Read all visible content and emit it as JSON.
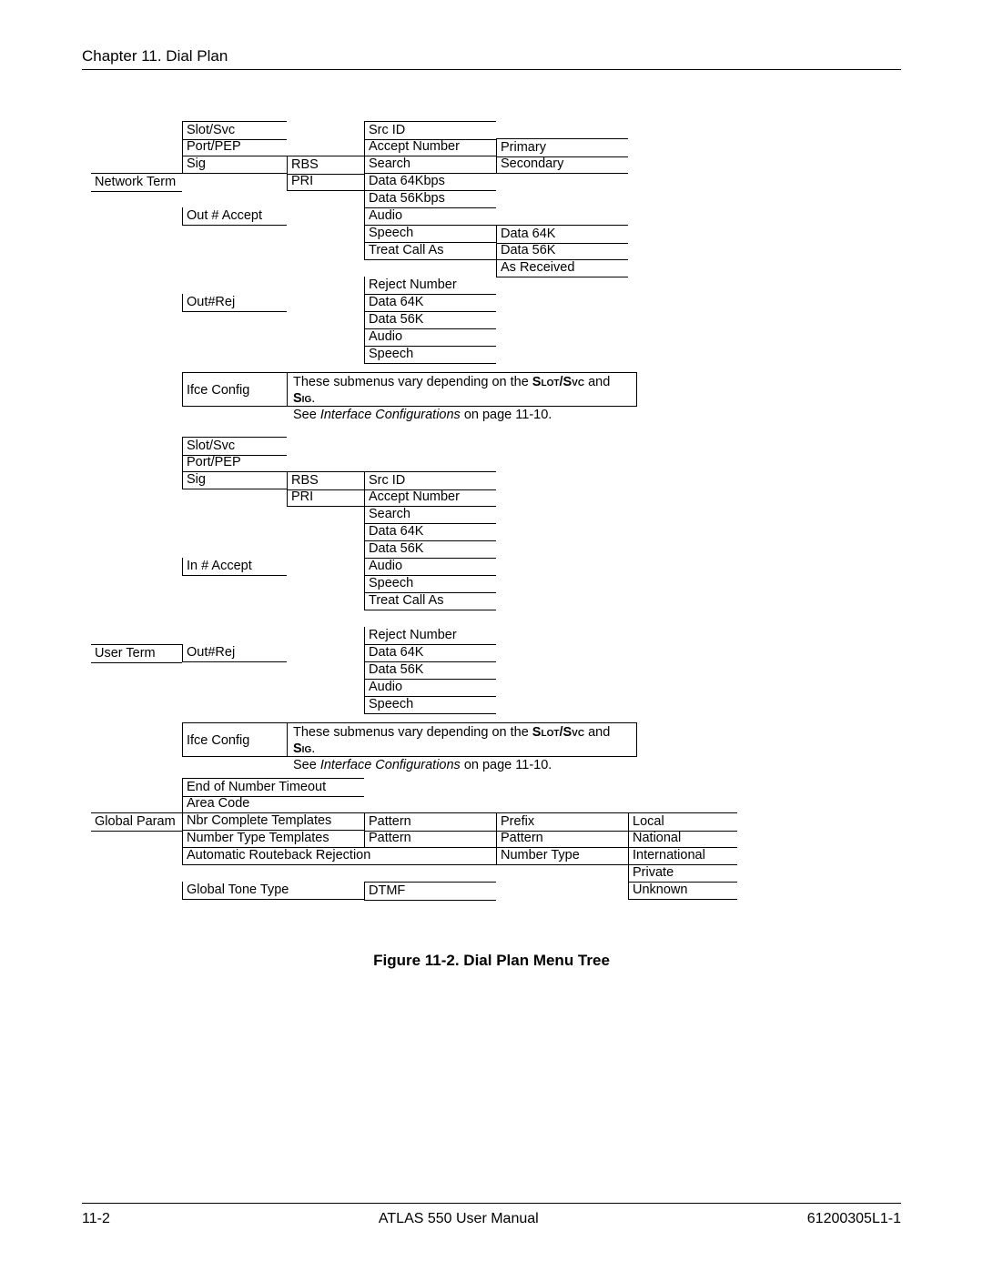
{
  "chapter": "Chapter 11.  Dial Plan",
  "caption": "Figure 11-2.  Dial Plan Menu Tree",
  "footer": {
    "left": "11-2",
    "center": "ATLAS 550 User Manual",
    "right": "61200305L1-1"
  },
  "col1": {
    "network_term": "Network Term",
    "user_term": "User Term",
    "global_param": "Global Param"
  },
  "col2": {
    "slot_svc": "Slot/Svc",
    "port_pep": "Port/PEP",
    "sig": "Sig",
    "out_accept": "Out # Accept",
    "out_rej": "Out#Rej",
    "ifce_config": "Ifce Config",
    "slot_svc2": "Slot/Svc",
    "port_pep2": "Port/PEP",
    "sig2": "Sig",
    "in_accept": "In # Accept",
    "out_rej2": "Out#Rej",
    "ifce_config2": "Ifce Config",
    "eon": "End of Number Timeout",
    "area_code": "Area Code",
    "nbr_complete": "Nbr Complete Templates",
    "number_type": "Number Type Templates",
    "auto_routeback": "Automatic Routeback Rejection",
    "global_tone": "Global Tone Type"
  },
  "col3": {
    "rbs": "RBS",
    "pri": "PRI",
    "rbs2": "RBS",
    "pri2": "PRI"
  },
  "col4": {
    "src_id": "Src ID",
    "accept_number": "Accept Number",
    "search": "Search",
    "d64kbps": "Data 64Kbps",
    "d56kbps": "Data 56Kbps",
    "audio": "Audio",
    "speech": "Speech",
    "treat_call": "Treat Call As",
    "reject_number": "Reject Number",
    "d64k": "Data 64K",
    "d56k": "Data 56K",
    "audio2": "Audio",
    "speech2": "Speech",
    "src_id2": "Src ID",
    "accept_number2": "Accept Number",
    "search2": "Search",
    "d64k2": "Data 64K",
    "d56k2": "Data 56K",
    "audio3": "Audio",
    "speech3": "Speech",
    "treat_call2": "Treat Call As",
    "reject_number2": "Reject Number",
    "d64k3": "Data 64K",
    "d56k3": "Data 56K",
    "audio4": "Audio",
    "speech4": "Speech",
    "pattern": "Pattern",
    "pattern2": "Pattern",
    "dtmf": "DTMF"
  },
  "col5": {
    "primary": "Primary",
    "secondary": "Secondary",
    "d64k": "Data 64K",
    "d56k": "Data 56K",
    "as_received": "As Received",
    "prefix": "Prefix",
    "pattern": "Pattern",
    "number_type": "Number Type"
  },
  "col6": {
    "local": "Local",
    "national": "National",
    "international": "International",
    "private": "Private",
    "unknown": "Unknown"
  },
  "note": {
    "pre": "These submenus vary depending on the ",
    "slot_svc": "Slot/Svc",
    "and": " and ",
    "sig": "Sig",
    "dot": ".",
    "see": "See ",
    "ital": "Interface Configurations",
    "post": " on page 11-10."
  }
}
